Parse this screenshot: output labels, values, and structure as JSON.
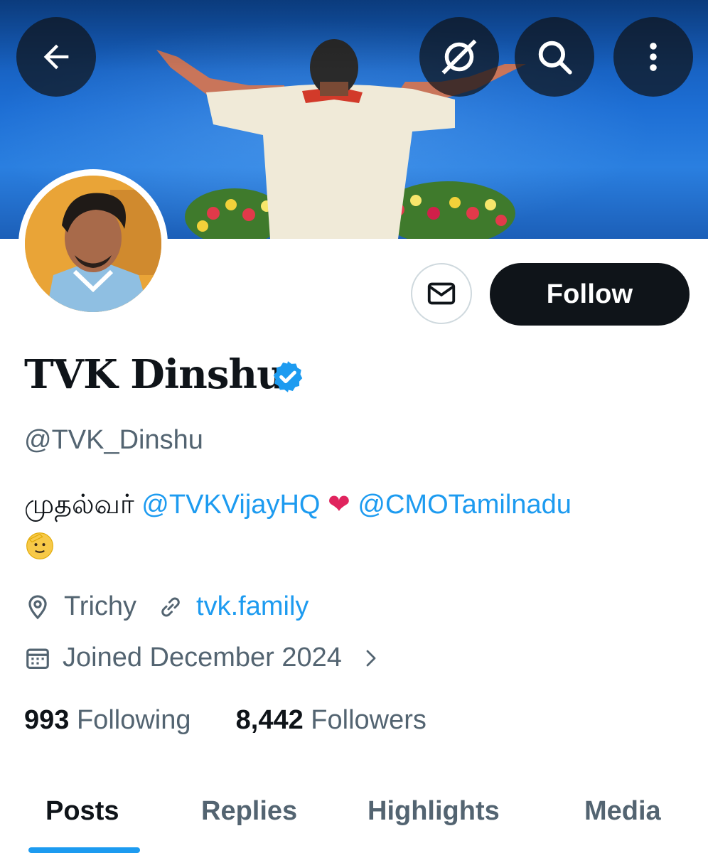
{
  "profile": {
    "display_name": "TVK Dinshu",
    "handle": "@TVK_Dinshu",
    "bio": {
      "prefix": "முதல்வர் ",
      "mention1": "@TVKVijayHQ",
      "heart": "❤",
      "mention2": "@CMOTamilnadu"
    },
    "location": "Trichy",
    "website": "tvk.family",
    "joined": "Joined December 2024"
  },
  "actions": {
    "follow_label": "Follow"
  },
  "stats": {
    "following_count": "993",
    "following_label": "Following",
    "followers_count": "8,442",
    "followers_label": "Followers"
  },
  "tabs": [
    {
      "label": "Posts",
      "active": true
    },
    {
      "label": "Replies",
      "active": false
    },
    {
      "label": "Highlights",
      "active": false
    },
    {
      "label": "Media",
      "active": false
    }
  ],
  "icons": {
    "back": "back-arrow-icon",
    "grok": "grok-icon",
    "search": "search-icon",
    "more": "more-vertical-icon",
    "message": "envelope-icon",
    "verified": "verified-badge-icon",
    "location": "location-pin-icon",
    "link": "link-icon",
    "calendar": "calendar-icon",
    "chevron": "chevron-right-icon"
  },
  "colors": {
    "accent": "#1d9bf0",
    "text_primary": "#0f1419",
    "text_secondary": "#536471",
    "follow_bg": "#0f1419"
  }
}
